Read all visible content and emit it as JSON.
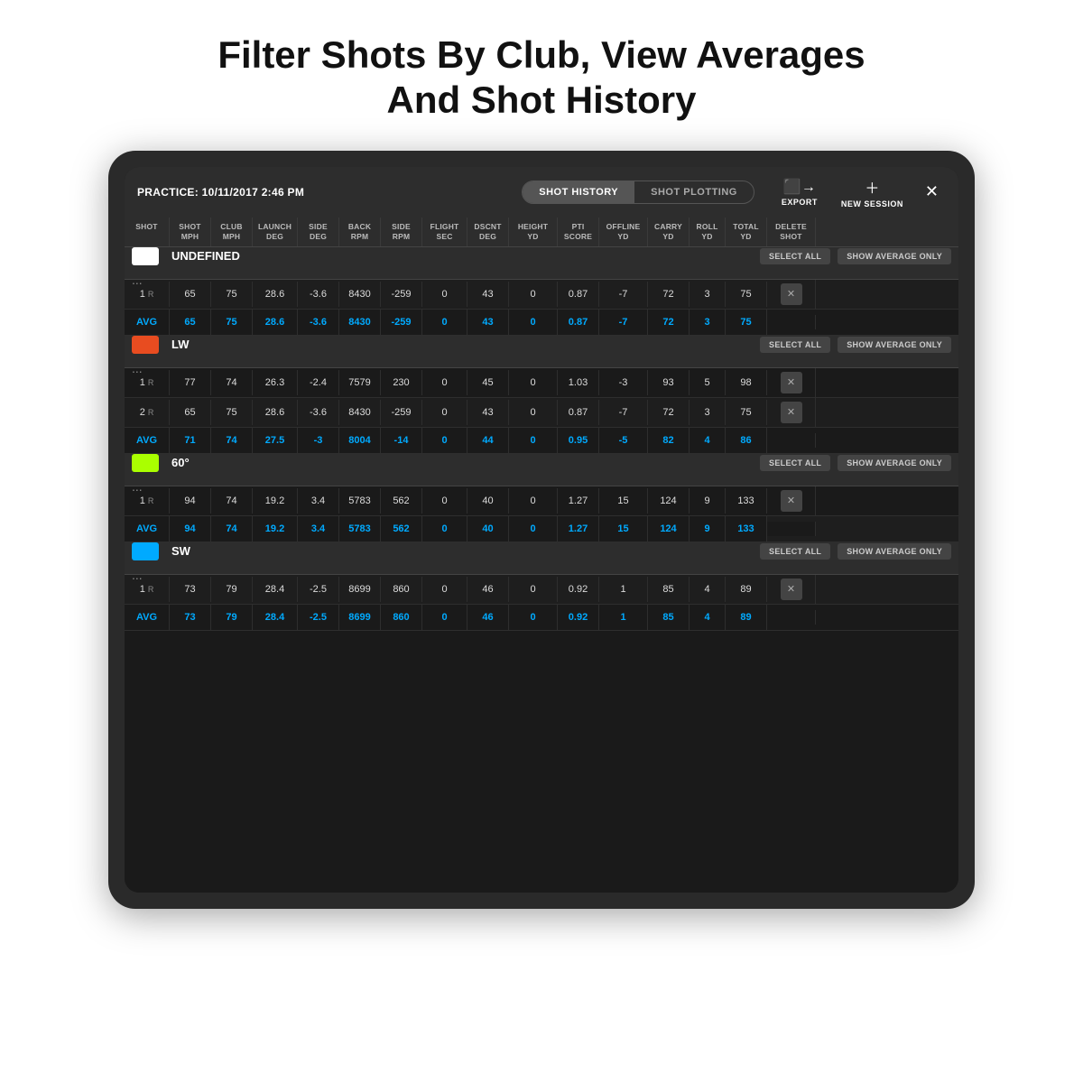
{
  "page": {
    "title_line1": "Filter Shots By Club, View Averages",
    "title_line2": "And Shot History"
  },
  "header": {
    "practice_label": "PRACTICE: 10/11/2017 2:46 PM",
    "tab_history": "SHOT HISTORY",
    "tab_plotting": "SHOT PLOTTING",
    "export_label": "EXPORT",
    "new_session_label": "NEW SESSION"
  },
  "columns": [
    {
      "key": "shot",
      "label": "SHOT"
    },
    {
      "key": "shot_mph",
      "label": "SHOT\nMPH"
    },
    {
      "key": "club_mph",
      "label": "CLUB\nMPH"
    },
    {
      "key": "launch_deg",
      "label": "LAUNCH\nDEG"
    },
    {
      "key": "side_deg",
      "label": "SIDE\nDEG"
    },
    {
      "key": "back_rpm",
      "label": "BACK\nRPM"
    },
    {
      "key": "side_rpm",
      "label": "SIDE\nRPM"
    },
    {
      "key": "flight_sec",
      "label": "FLIGHT\nSEC"
    },
    {
      "key": "dscnt_deg",
      "label": "DSCNT\nDEG"
    },
    {
      "key": "height_yd",
      "label": "HEIGHT\nYD"
    },
    {
      "key": "pti_score",
      "label": "PTI\nSCORE"
    },
    {
      "key": "offline_yd",
      "label": "OFFLINE\nYD"
    },
    {
      "key": "carry_yd",
      "label": "CARRY\nYD"
    },
    {
      "key": "roll_yd",
      "label": "ROLL\nYD"
    },
    {
      "key": "total_yd",
      "label": "TOTAL\nYD"
    },
    {
      "key": "delete_shot",
      "label": "DELETE\nSHOT"
    }
  ],
  "clubs": [
    {
      "name": "UNDEFINED",
      "color": "#ffffff",
      "shots": [
        {
          "num": 1,
          "type": "R",
          "shot_mph": 65,
          "club_mph": 75,
          "launch_deg": 28.6,
          "side_deg": -3.6,
          "back_rpm": 8430,
          "side_rpm": -259,
          "flight_sec": 0.0,
          "dscnt_deg": 43,
          "height_yd": 0.0,
          "pti_score": 0.87,
          "offline_yd": -7,
          "carry_yd": 72,
          "roll_yd": 3,
          "total_yd": 75
        }
      ],
      "avg": {
        "shot_mph": 65,
        "club_mph": 75,
        "launch_deg": 28.6,
        "side_deg": -3.6,
        "back_rpm": 8430,
        "side_rpm": -259,
        "flight_sec": 0.0,
        "dscnt_deg": 43,
        "height_yd": 0,
        "pti_score": 0.87,
        "offline_yd": -7,
        "carry_yd": 72,
        "roll_yd": 3,
        "total_yd": 75
      }
    },
    {
      "name": "LW",
      "color": "#e84c20",
      "shots": [
        {
          "num": 1,
          "type": "R",
          "shot_mph": 77,
          "club_mph": 74,
          "launch_deg": 26.3,
          "side_deg": -2.4,
          "back_rpm": 7579,
          "side_rpm": 230,
          "flight_sec": 0.0,
          "dscnt_deg": 45,
          "height_yd": 0.0,
          "pti_score": 1.03,
          "offline_yd": -3,
          "carry_yd": 93,
          "roll_yd": 5,
          "total_yd": 98
        },
        {
          "num": 2,
          "type": "R",
          "shot_mph": 65,
          "club_mph": 75,
          "launch_deg": 28.6,
          "side_deg": -3.6,
          "back_rpm": 8430,
          "side_rpm": -259,
          "flight_sec": 0.0,
          "dscnt_deg": 43,
          "height_yd": 0.0,
          "pti_score": 0.87,
          "offline_yd": -7,
          "carry_yd": 72,
          "roll_yd": 3,
          "total_yd": 75
        }
      ],
      "avg": {
        "shot_mph": 71,
        "club_mph": 74,
        "launch_deg": 27.5,
        "side_deg": -3.0,
        "back_rpm": 8004,
        "side_rpm": -14,
        "flight_sec": 0.0,
        "dscnt_deg": 44,
        "height_yd": 0,
        "pti_score": 0.95,
        "offline_yd": -5,
        "carry_yd": 82,
        "roll_yd": 4,
        "total_yd": 86
      }
    },
    {
      "name": "60°",
      "color": "#aaff00",
      "shots": [
        {
          "num": 1,
          "type": "R",
          "shot_mph": 94,
          "club_mph": 74,
          "launch_deg": 19.2,
          "side_deg": 3.4,
          "back_rpm": 5783,
          "side_rpm": 562,
          "flight_sec": 0.0,
          "dscnt_deg": 40,
          "height_yd": 0.0,
          "pti_score": 1.27,
          "offline_yd": 15,
          "carry_yd": 124,
          "roll_yd": 9,
          "total_yd": 133
        }
      ],
      "avg": {
        "shot_mph": 94,
        "club_mph": 74,
        "launch_deg": 19.2,
        "side_deg": 3.4,
        "back_rpm": 5783,
        "side_rpm": 562,
        "flight_sec": 0.0,
        "dscnt_deg": 40,
        "height_yd": 0,
        "pti_score": 1.27,
        "offline_yd": 15,
        "carry_yd": 124,
        "roll_yd": 9,
        "total_yd": 133
      }
    },
    {
      "name": "SW",
      "color": "#00aaff",
      "shots": [
        {
          "num": 1,
          "type": "R",
          "shot_mph": 73,
          "club_mph": 79,
          "launch_deg": 28.4,
          "side_deg": -2.5,
          "back_rpm": 8699,
          "side_rpm": 860,
          "flight_sec": 0.0,
          "dscnt_deg": 46,
          "height_yd": 0.0,
          "pti_score": 0.92,
          "offline_yd": 1,
          "carry_yd": 85,
          "roll_yd": 4,
          "total_yd": 89
        }
      ],
      "avg": {
        "shot_mph": 73,
        "club_mph": 79,
        "launch_deg": 28.4,
        "side_deg": -2.5,
        "back_rpm": 8699,
        "side_rpm": 860,
        "flight_sec": 0.0,
        "dscnt_deg": 46,
        "height_yd": 0,
        "pti_score": 0.92,
        "offline_yd": 1,
        "carry_yd": 85,
        "roll_yd": 4,
        "total_yd": 89
      }
    }
  ],
  "buttons": {
    "select_all": "SELECT ALL",
    "show_average_only": "SHOW AVERAGE ONLY",
    "avg_label": "AVG"
  }
}
